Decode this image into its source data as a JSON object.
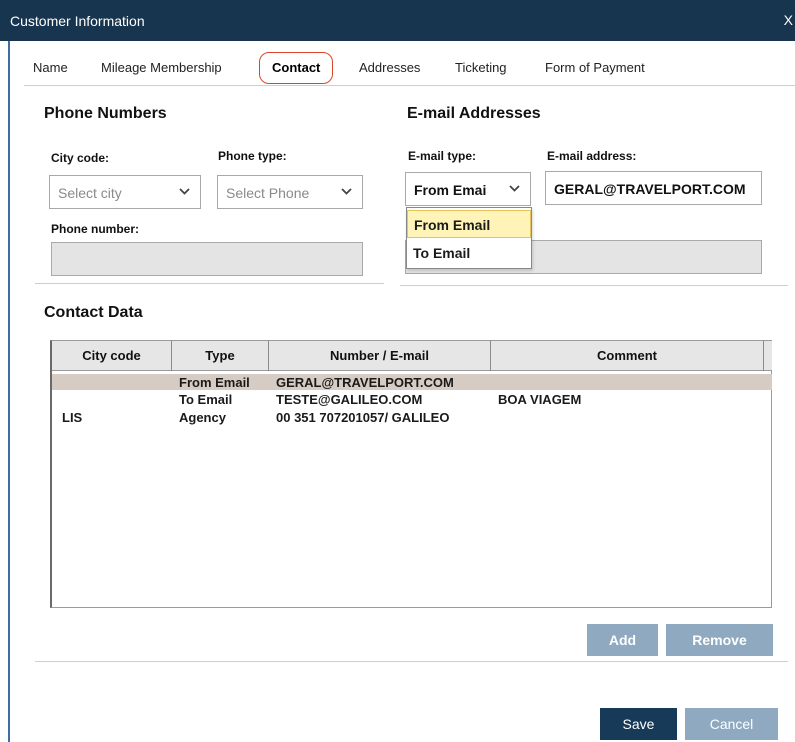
{
  "window": {
    "title": "Customer Information",
    "close": "X"
  },
  "tabs": [
    {
      "label": "Name"
    },
    {
      "label": "Mileage Membership"
    },
    {
      "label": "Contact"
    },
    {
      "label": "Addresses"
    },
    {
      "label": "Ticketing"
    },
    {
      "label": "Form of Payment"
    }
  ],
  "phone": {
    "heading": "Phone Numbers",
    "city_code_label": "City code:",
    "city_code_value": "Select city",
    "phone_type_label": "Phone type:",
    "phone_type_value": "Select Phone",
    "phone_number_label": "Phone number:",
    "phone_number_value": ""
  },
  "email": {
    "heading": "E-mail Addresses",
    "type_label": "E-mail type:",
    "type_value": "From Emai",
    "address_label": "E-mail address:",
    "address_value": "GERAL@TRAVELPORT.COM",
    "dropdown_options": [
      "From Email",
      "To Email"
    ]
  },
  "contact_data": {
    "heading": "Contact Data",
    "columns": [
      "City code",
      "Type",
      "Number / E-mail",
      "Comment"
    ],
    "rows": [
      {
        "city": "",
        "type": "From Email",
        "number": "GERAL@TRAVELPORT.COM",
        "comment": ""
      },
      {
        "city": "",
        "type": "To Email",
        "number": "TESTE@GALILEO.COM",
        "comment": "BOA VIAGEM"
      },
      {
        "city": "LIS",
        "type": "Agency",
        "number": "00 351 707201057/ GALILEO",
        "comment": ""
      }
    ]
  },
  "buttons": {
    "add": "Add",
    "remove": "Remove",
    "save": "Save",
    "cancel": "Cancel"
  }
}
